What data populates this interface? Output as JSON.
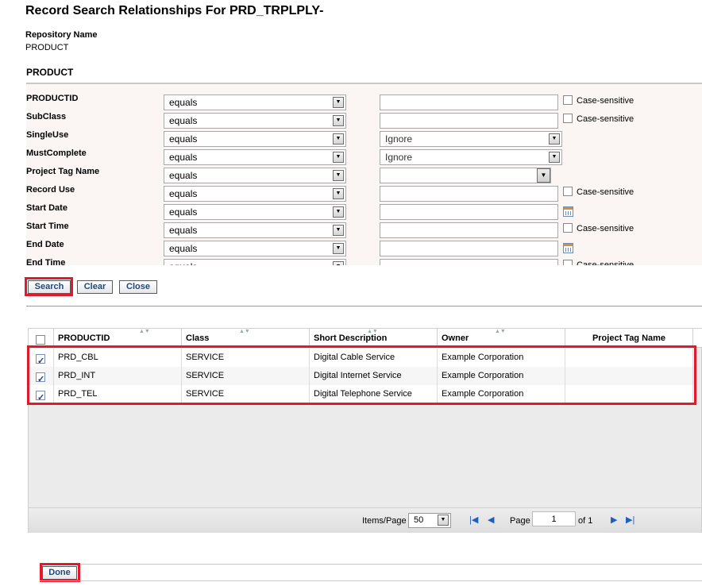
{
  "page": {
    "title": "Record Search Relationships For PRD_TRPLPLY-",
    "repository_label": "Repository Name",
    "repository_value": "PRODUCT",
    "section_title": "PRODUCT"
  },
  "criteria": [
    {
      "label": "PRODUCTID",
      "operator": "equals",
      "value_type": "text",
      "value": "",
      "case_label": "Case-sensitive"
    },
    {
      "label": "SubClass",
      "operator": "equals",
      "value_type": "text",
      "value": "",
      "case_label": "Case-sensitive"
    },
    {
      "label": "SingleUse",
      "operator": "equals",
      "value_type": "select",
      "value": "Ignore"
    },
    {
      "label": "MustComplete",
      "operator": "equals",
      "value_type": "select",
      "value": "Ignore"
    },
    {
      "label": "Project Tag Name",
      "operator": "equals",
      "value_type": "tag",
      "value": ""
    },
    {
      "label": "Record Use",
      "operator": "equals",
      "value_type": "text",
      "value": "",
      "case_label": "Case-sensitive"
    },
    {
      "label": "Start Date",
      "operator": "equals",
      "value_type": "date",
      "value": ""
    },
    {
      "label": "Start Time",
      "operator": "equals",
      "value_type": "text",
      "value": "",
      "case_label": "Case-sensitive"
    },
    {
      "label": "End Date",
      "operator": "equals",
      "value_type": "date",
      "value": ""
    },
    {
      "label": "End Time",
      "operator": "equals",
      "value_type": "text",
      "value": "",
      "case_label": "Case-sensitive"
    }
  ],
  "buttons": {
    "search": "Search",
    "clear": "Clear",
    "close": "Close",
    "done": "Done"
  },
  "grid": {
    "columns": [
      "PRODUCTID",
      "Class",
      "Short Description",
      "Owner",
      "Project Tag Name"
    ],
    "rows": [
      {
        "checked": true,
        "productid": "PRD_CBL",
        "class": "SERVICE",
        "description": "Digital Cable Service",
        "owner": "Example Corporation",
        "tag": ""
      },
      {
        "checked": true,
        "productid": "PRD_INT",
        "class": "SERVICE",
        "description": "Digital Internet Service",
        "owner": "Example Corporation",
        "tag": ""
      },
      {
        "checked": true,
        "productid": "PRD_TEL",
        "class": "SERVICE",
        "description": "Digital Telephone Service",
        "owner": "Example Corporation",
        "tag": ""
      }
    ]
  },
  "pager": {
    "items_label": "Items/Page",
    "items_value": "50",
    "page_label": "Page",
    "page_value": "1",
    "of_label": "of 1"
  },
  "colors": {
    "highlight": "#e2182b",
    "button_text": "#23487a",
    "nav": "#1d5fc4"
  }
}
